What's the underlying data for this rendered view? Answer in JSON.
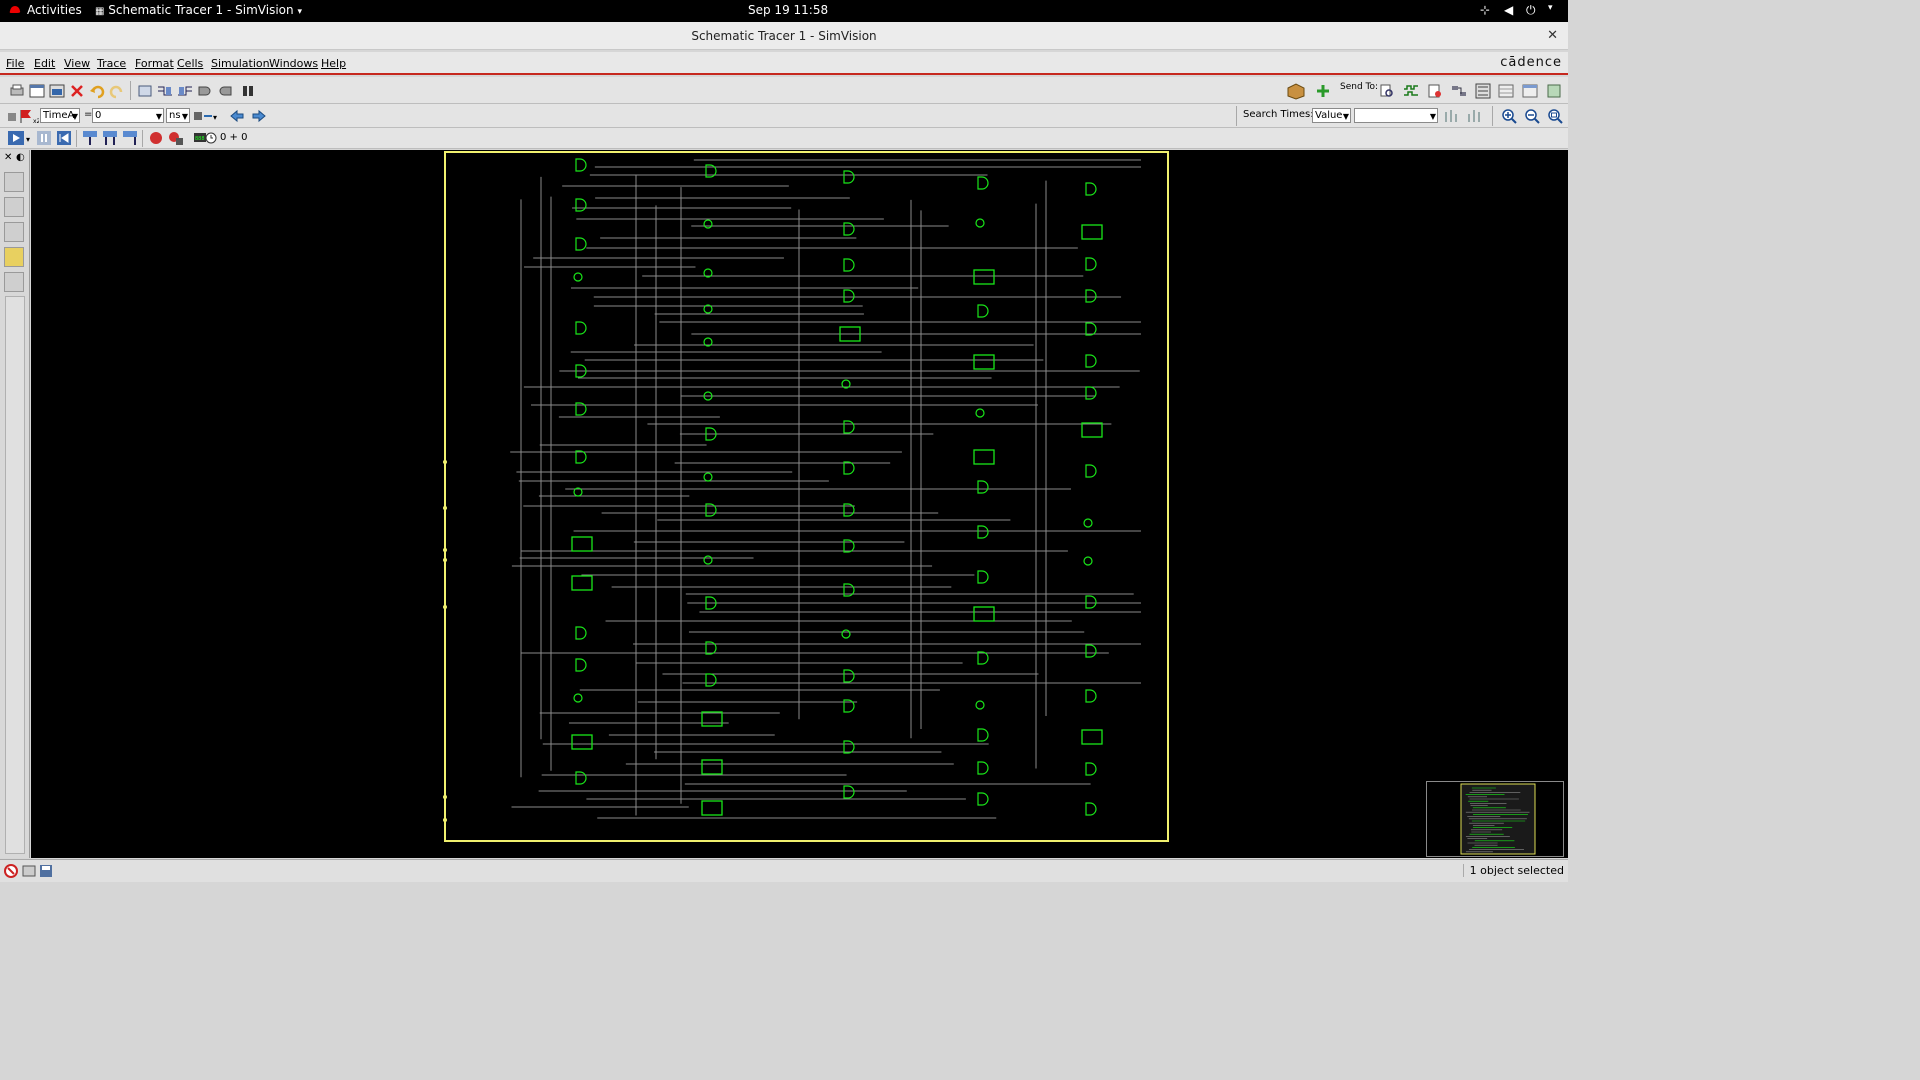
{
  "topbar": {
    "activities": "Activities",
    "app_menu": "Schematic Tracer 1 - SimVision",
    "clock": "Sep 19  11:58"
  },
  "window": {
    "title": "Schematic Tracer 1 - SimVision",
    "close_glyph": "✕"
  },
  "menu": {
    "file": "File",
    "edit": "Edit",
    "view": "View",
    "trace": "Trace",
    "format": "Format",
    "cells": "Cells",
    "simulation": "Simulation",
    "windows": "Windows",
    "help": "Help",
    "brand": "cādence"
  },
  "toolbar": {
    "send_to": "Send To:",
    "cursor_select": "TimeA",
    "equals": "=",
    "time_value": "0",
    "time_unit": "ns",
    "search_times_label": "Search Times:",
    "search_mode": "Value",
    "search_value": "",
    "sim_time": "0 + 0"
  },
  "status": {
    "selection": "1 object selected"
  },
  "colors": {
    "accent_red": "#c6281e",
    "schematic_wire": "#8a8a8a",
    "schematic_gate": "#19e619",
    "module_border": "#f0f06e"
  }
}
